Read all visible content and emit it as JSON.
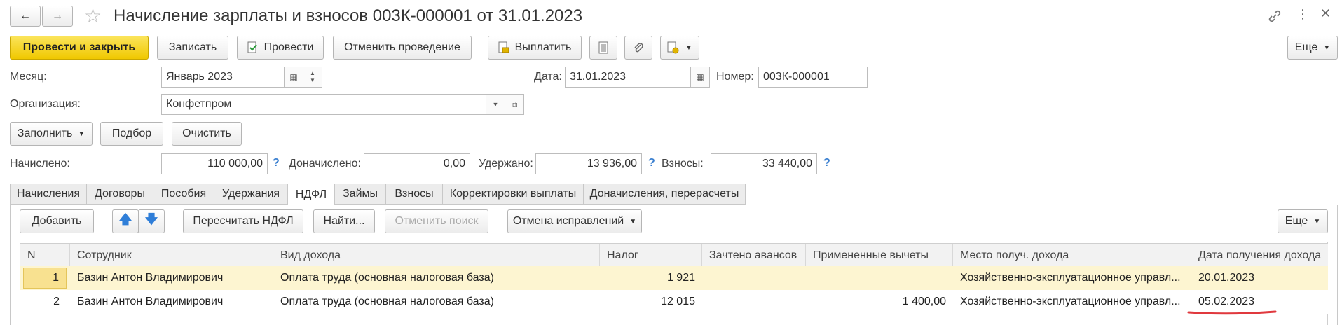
{
  "header": {
    "title": "Начисление зарплаты и взносов 003К-000001 от 31.01.2023"
  },
  "toolbar": {
    "post_close": "Провести и закрыть",
    "write": "Записать",
    "post": "Провести",
    "cancel_post": "Отменить проведение",
    "pay": "Выплатить",
    "more": "Еще"
  },
  "form": {
    "month_label": "Месяц:",
    "month_value": "Январь 2023",
    "date_label": "Дата:",
    "date_value": "31.01.2023",
    "number_label": "Номер:",
    "number_value": "003К-000001",
    "org_label": "Организация:",
    "org_value": "Конфетпром"
  },
  "actions": {
    "fill": "Заполнить",
    "select": "Подбор",
    "clear": "Очистить"
  },
  "totals": {
    "accrued_label": "Начислено:",
    "accrued_value": "110 000,00",
    "extra_label": "Доначислено:",
    "extra_value": "0,00",
    "withheld_label": "Удержано:",
    "withheld_value": "13 936,00",
    "contrib_label": "Взносы:",
    "contrib_value": "33 440,00",
    "help": "?"
  },
  "tabs": [
    {
      "label": "Начисления"
    },
    {
      "label": "Договоры"
    },
    {
      "label": "Пособия"
    },
    {
      "label": "Удержания"
    },
    {
      "label": "НДФЛ"
    },
    {
      "label": "Займы"
    },
    {
      "label": "Взносы"
    },
    {
      "label": "Корректировки выплаты"
    },
    {
      "label": "Доначисления, перерасчеты"
    }
  ],
  "ndfl_toolbar": {
    "add": "Добавить",
    "recalc": "Пересчитать НДФЛ",
    "find": "Найти...",
    "cancel_search": "Отменить поиск",
    "cancel_fix": "Отмена исправлений",
    "more": "Еще"
  },
  "table": {
    "columns": [
      "N",
      "Сотрудник",
      "Вид дохода",
      "Налог",
      "Зачтено авансов",
      "Примененные вычеты",
      "Место получ. дохода",
      "Дата получения дохода"
    ],
    "rows": [
      {
        "n": "1",
        "employee": "Базин Антон Владимирович",
        "income": "Оплата труда (основная налоговая база)",
        "tax": "1 921",
        "advances": "",
        "deductions": "",
        "place": "Хозяйственно-эксплуатационное управл...",
        "date": "20.01.2023"
      },
      {
        "n": "2",
        "employee": "Базин Антон Владимирович",
        "income": "Оплата труда (основная налоговая база)",
        "tax": "12 015",
        "advances": "",
        "deductions": "1 400,00",
        "place": "Хозяйственно-эксплуатационное управл...",
        "date": "05.02.2023"
      }
    ]
  },
  "colors": {
    "primary": "#f5d000",
    "selected_row": "#fdf5d1",
    "underline": "#e0393e",
    "help": "#3a7fd0"
  }
}
